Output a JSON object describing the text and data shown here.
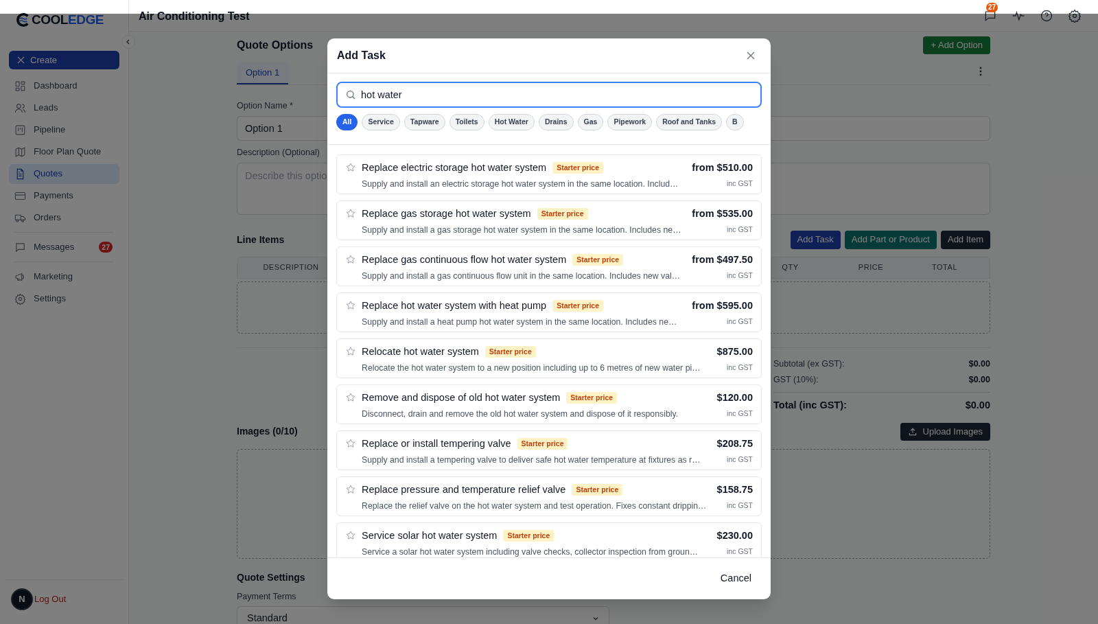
{
  "header": {
    "title": "Air Conditioning Test",
    "messages_badge": "27"
  },
  "sidebar": {
    "logo": {
      "first": "COOL",
      "second": "EDGE"
    },
    "create_button": "Create",
    "groups": [
      [
        {
          "label": "Dashboard",
          "selected": false
        },
        {
          "label": "Leads",
          "selected": false
        },
        {
          "label": "Pipeline",
          "selected": false
        },
        {
          "label": "Floor Plan Quote",
          "selected": false
        },
        {
          "label": "Quotes",
          "selected": true
        },
        {
          "label": "Payments",
          "selected": false
        },
        {
          "label": "Orders",
          "selected": false
        }
      ],
      [
        {
          "label": "Messages",
          "selected": false,
          "badge": "27"
        }
      ],
      [
        {
          "label": "Marketing",
          "selected": false
        },
        {
          "label": "Settings",
          "selected": false
        }
      ]
    ],
    "avatar": "N",
    "logout": "Log Out"
  },
  "quote": {
    "title": "Quote Options",
    "add_option": "+ Add Option",
    "tabs": [
      {
        "label": "Option 1",
        "selected": true
      }
    ],
    "option_name_label": "Option Name *",
    "option_name": "Option 1",
    "description_label": "Description (Optional)",
    "description_placeholder": "Describe this optio",
    "line_items_title": "Line Items",
    "buttons": [
      "Add Task",
      "Add Part or Product",
      "Add Item"
    ],
    "columns": [
      "DESCRIPTION",
      "QTY",
      "PRICE",
      "TOTAL"
    ],
    "totals": [
      {
        "label": "Subtotal (ex GST):",
        "value": "$0.00",
        "kind": "plain"
      },
      {
        "label": "GST (10%):",
        "value": "$0.00",
        "kind": "plain"
      },
      {
        "label": "Total (inc GST):",
        "value": "$0.00",
        "kind": "grand"
      }
    ],
    "images_title": "Images (0/10)",
    "upload_button": "Upload Images",
    "settings_title": "Quote Settings",
    "payment_terms_label": "Payment Terms",
    "payment_terms": "Standard"
  },
  "modal": {
    "title": "Add Task",
    "search": {
      "value": "hot water"
    },
    "filters": [
      {
        "label": "All",
        "selected": true
      },
      {
        "label": "Service",
        "selected": false
      },
      {
        "label": "Tapware",
        "selected": false
      },
      {
        "label": "Toilets",
        "selected": false
      },
      {
        "label": "Hot Water",
        "selected": false
      },
      {
        "label": "Drains",
        "selected": false
      },
      {
        "label": "Gas",
        "selected": false
      },
      {
        "label": "Pipework",
        "selected": false
      },
      {
        "label": "Roof and Tanks",
        "selected": false
      },
      {
        "label": "B",
        "selected": false
      }
    ],
    "tasks": [
      {
        "title": "Replace electric storage hot water system",
        "badge": "Starter price",
        "description": "Supply and install an electric storage hot water system in the same location. Includ…",
        "price": "from $510.00",
        "price_note": "inc GST"
      },
      {
        "title": "Replace gas storage hot water system",
        "badge": "Starter price",
        "description": "Supply and install a gas storage hot water system in the same location. Includes ne…",
        "price": "from $535.00",
        "price_note": "inc GST"
      },
      {
        "title": "Replace gas continuous flow hot water system",
        "badge": "Starter price",
        "description": "Supply and install a gas continuous flow unit in the same location. Includes new val…",
        "price": "from $497.50",
        "price_note": "inc GST"
      },
      {
        "title": "Replace hot water system with heat pump",
        "badge": "Starter price",
        "description": "Supply and install a heat pump hot water system in the same location. Includes ne…",
        "price": "from $595.00",
        "price_note": "inc GST"
      },
      {
        "title": "Relocate hot water system",
        "badge": "Starter price",
        "description": "Relocate the hot water system to a new position including up to 6 metres of new water pi…",
        "price": "$875.00",
        "price_note": "inc GST"
      },
      {
        "title": "Remove and dispose of old hot water system",
        "badge": "Starter price",
        "description": "Disconnect, drain and remove the old hot water system and dispose of it responsibly.",
        "price": "$120.00",
        "price_note": "inc GST"
      },
      {
        "title": "Replace or install tempering valve",
        "badge": "Starter price",
        "description": "Supply and install a tempering valve to deliver safe hot water temperature at fixtures as r…",
        "price": "$208.75",
        "price_note": "inc GST"
      },
      {
        "title": "Replace pressure and temperature relief valve",
        "badge": "Starter price",
        "description": "Replace the relief valve on the hot water system and test operation. Fixes constant drippin…",
        "price": "$158.75",
        "price_note": "inc GST"
      },
      {
        "title": "Service solar hot water system",
        "badge": "Starter price",
        "description": "Service a solar hot water system including valve checks, collector inspection from groun…",
        "price": "$230.00",
        "price_note": "inc GST"
      }
    ],
    "cancel": "Cancel"
  }
}
